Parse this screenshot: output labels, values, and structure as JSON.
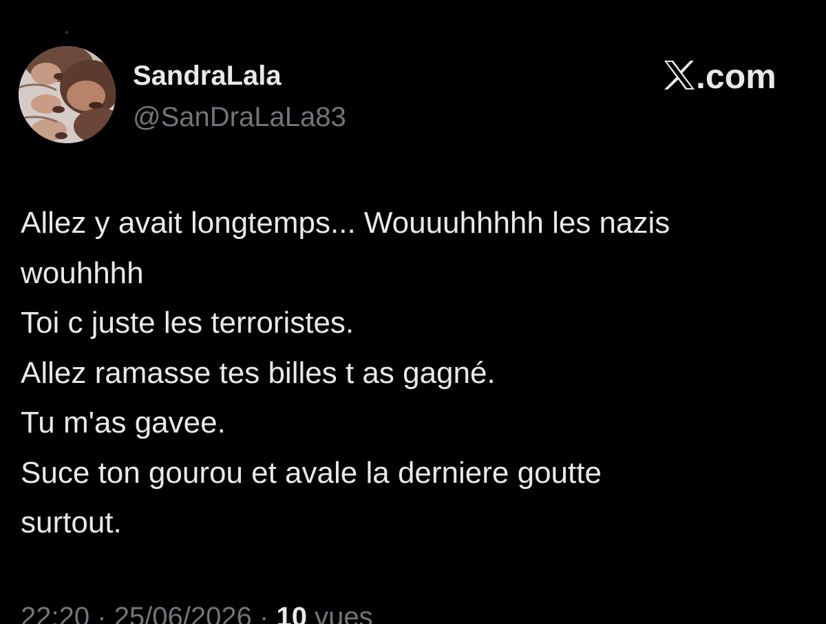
{
  "post": {
    "author": {
      "display_name": "SandraLala",
      "handle": "@SanDraLaLa83"
    },
    "brand": {
      "text": ".com",
      "icon": "x-logo-icon"
    },
    "text_lines": [
      "Allez y avait longtemps... Wouuuhhhhh les nazis",
      "wouhhhh",
      "Toi c juste les terroristes.",
      "Allez ramasse tes billes t as gagné.",
      "Tu m'as gavee.",
      "Suce ton gourou et avale la derniere goutte",
      "surtout."
    ],
    "meta": {
      "time": "22:20",
      "date": "25/06/2026",
      "separator": "·",
      "views_count": "10",
      "views_label": "vues"
    }
  },
  "colors": {
    "background": "#000000",
    "primary_text": "#e7e9ea",
    "secondary_text": "#71767b"
  }
}
